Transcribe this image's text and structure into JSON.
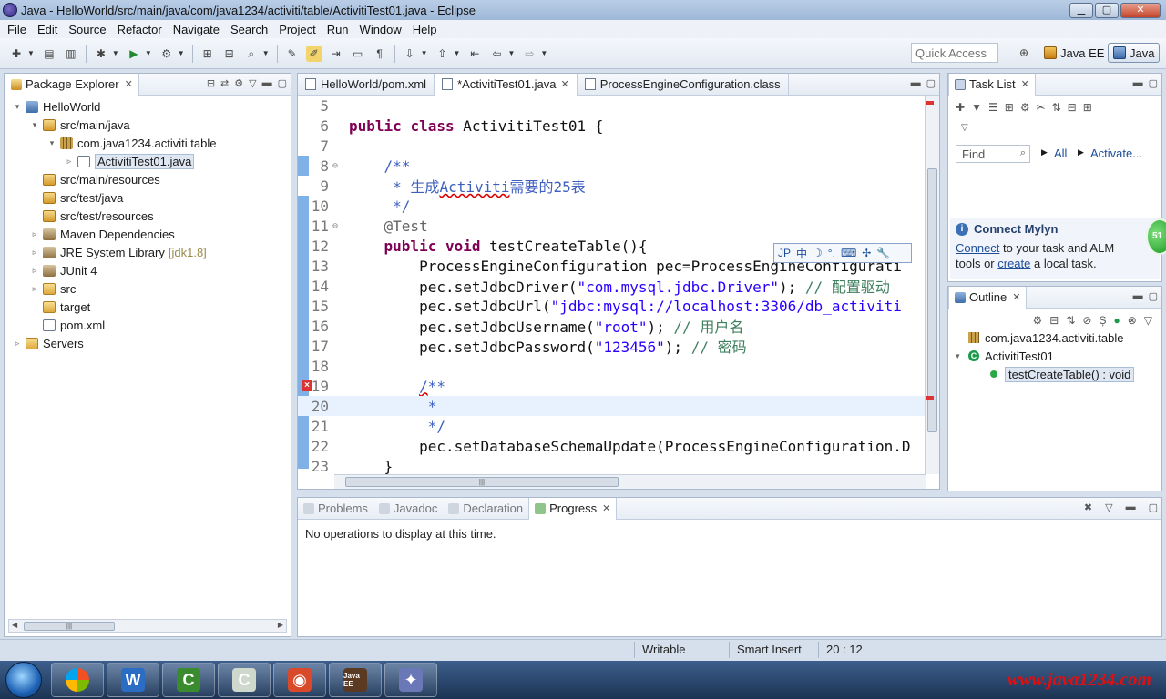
{
  "window": {
    "title": "Java - HelloWorld/src/main/java/com/java1234/activiti/table/ActivitiTest01.java - Eclipse",
    "minimize": "▁",
    "maximize": "▢",
    "close": "✕"
  },
  "menu": [
    "File",
    "Edit",
    "Source",
    "Refactor",
    "Navigate",
    "Search",
    "Project",
    "Run",
    "Window",
    "Help"
  ],
  "toolbar": {
    "quick_access": "Quick Access",
    "perspective_javaee": "Java EE",
    "perspective_java": "Java"
  },
  "package_explorer": {
    "tab_label": "Package Explorer",
    "tree": [
      {
        "label": "HelloWorld",
        "icon": "project-icon",
        "depth": 0,
        "twisty": "▾"
      },
      {
        "label": "src/main/java",
        "icon": "source-folder-icon",
        "depth": 1,
        "twisty": "▾"
      },
      {
        "label": "com.java1234.activiti.table",
        "icon": "package-icon",
        "depth": 2,
        "twisty": "▾"
      },
      {
        "label": "ActivitiTest01.java",
        "icon": "java-file-icon",
        "depth": 3,
        "twisty": "▹",
        "selected": true
      },
      {
        "label": "src/main/resources",
        "icon": "source-folder-icon",
        "depth": 1,
        "twisty": ""
      },
      {
        "label": "src/test/java",
        "icon": "source-folder-icon",
        "depth": 1,
        "twisty": ""
      },
      {
        "label": "src/test/resources",
        "icon": "source-folder-icon",
        "depth": 1,
        "twisty": ""
      },
      {
        "label": "Maven Dependencies",
        "icon": "library-icon",
        "depth": 1,
        "twisty": "▹"
      },
      {
        "label": "JRE System Library",
        "decor": "[jdk1.8]",
        "icon": "library-icon",
        "depth": 1,
        "twisty": "▹"
      },
      {
        "label": "JUnit 4",
        "icon": "library-icon",
        "depth": 1,
        "twisty": "▹"
      },
      {
        "label": "src",
        "icon": "folder-icon",
        "depth": 1,
        "twisty": "▹"
      },
      {
        "label": "target",
        "icon": "folder-icon",
        "depth": 1,
        "twisty": ""
      },
      {
        "label": "pom.xml",
        "icon": "xml-file-icon",
        "depth": 1,
        "twisty": ""
      },
      {
        "label": "Servers",
        "icon": "servers-folder-icon",
        "depth": 0,
        "twisty": "▹"
      }
    ]
  },
  "editor": {
    "tabs": [
      {
        "label": "HelloWorld/pom.xml",
        "active": false
      },
      {
        "label": "*ActivitiTest01.java",
        "active": true
      },
      {
        "label": "ProcessEngineConfiguration.class",
        "active": false
      }
    ],
    "lines": [
      {
        "n": "5",
        "fold": "",
        "html": ""
      },
      {
        "n": "6",
        "fold": "",
        "html": "<span class=\"kw\">public</span> <span class=\"kw\">class</span> ActivitiTest01 {"
      },
      {
        "n": "7",
        "fold": "",
        "html": ""
      },
      {
        "n": "8",
        "fold": "⊖",
        "html": "    <span class=\"jdoc\">/**</span>"
      },
      {
        "n": "9",
        "fold": "",
        "html": "<span class=\"jdoc\">     * 生成<span class=\"err-underline\">Activiti</span>需要的25表</span>"
      },
      {
        "n": "10",
        "fold": "",
        "html": "<span class=\"jdoc\">     */</span>"
      },
      {
        "n": "11",
        "fold": "⊖",
        "html": "    <span class=\"ann\">@Test</span>"
      },
      {
        "n": "12",
        "fold": "",
        "html": "    <span class=\"kw\">public</span> <span class=\"kw\">void</span> testCreateTable(){"
      },
      {
        "n": "13",
        "fold": "",
        "html": "        ProcessEngineConfiguration pec=ProcessEngineConfigurati"
      },
      {
        "n": "14",
        "fold": "",
        "html": "        pec.setJdbcDriver(<span class=\"str\">\"com.mysql.jdbc.Driver\"</span>); <span class=\"cmt\">// 配置驱动</span>"
      },
      {
        "n": "15",
        "fold": "",
        "html": "        pec.setJdbcUrl(<span class=\"str\">\"jdbc:mysql://localhost:3306/db_activiti</span>"
      },
      {
        "n": "16",
        "fold": "",
        "html": "        pec.setJdbcUsername(<span class=\"str\">\"root\"</span>); <span class=\"cmt\">// 用户名</span>"
      },
      {
        "n": "17",
        "fold": "",
        "html": "        pec.setJdbcPassword(<span class=\"str\">\"123456\"</span>); <span class=\"cmt\">// 密码</span>"
      },
      {
        "n": "18",
        "fold": "",
        "html": ""
      },
      {
        "n": "19",
        "fold": "",
        "html": "        <span class=\"jdoc\"><span class=\"err-underline\">/</span>**</span>"
      },
      {
        "n": "20",
        "fold": "",
        "html": "<span class=\"jdoc\">         *</span>",
        "current": true
      },
      {
        "n": "21",
        "fold": "",
        "html": "<span class=\"jdoc\">         */</span>"
      },
      {
        "n": "22",
        "fold": "",
        "html": "        pec.setDatabaseSchemaUpdate(ProcessEngineConfiguration.D"
      },
      {
        "n": "23",
        "fold": "",
        "html": "    }"
      }
    ],
    "ime_items": [
      "JP",
      "中",
      "☽",
      "°,",
      "⌨",
      "✢",
      "🔧"
    ]
  },
  "task_list": {
    "tab_label": "Task List",
    "find_placeholder": "Find",
    "all_label": "All",
    "activate_label": "Activate...",
    "mylyn_title": "Connect Mylyn",
    "mylyn_connect": "Connect",
    "mylyn_text1": " to your task and ALM",
    "mylyn_text2": "tools or ",
    "mylyn_create": "create",
    "mylyn_text3": " a local task."
  },
  "outline": {
    "tab_label": "Outline",
    "items": [
      {
        "label": "com.java1234.activiti.table",
        "icon": "package-icon",
        "depth": 0,
        "twisty": ""
      },
      {
        "label": "ActivitiTest01",
        "icon": "class-icon",
        "depth": 0,
        "twisty": "▾"
      },
      {
        "label": "testCreateTable() : void",
        "icon": "method-icon",
        "depth": 1,
        "twisty": "",
        "selected": true
      }
    ]
  },
  "bottom": {
    "tabs": [
      {
        "label": "Problems",
        "active": false
      },
      {
        "label": "Javadoc",
        "active": false
      },
      {
        "label": "Declaration",
        "active": false
      },
      {
        "label": "Progress",
        "active": true
      }
    ],
    "message": "No operations to display at this time."
  },
  "status": {
    "writable": "Writable",
    "insert_mode": "Smart Insert",
    "position": "20 : 12"
  },
  "taskbar": {
    "apps": [
      {
        "name": "word-app",
        "glyph": "W",
        "color": "#2b6cc4"
      },
      {
        "name": "camtasia-app",
        "glyph": "C",
        "color": "#3a8a2e"
      },
      {
        "name": "camtasia-recorder-app",
        "glyph": "C",
        "color": "#cfd8cc"
      },
      {
        "name": "chrome-app",
        "glyph": "◉",
        "color": "#d94a2a"
      },
      {
        "name": "eclipse-app",
        "glyph": "Java EE",
        "color": "#5a3a22"
      },
      {
        "name": "other-app",
        "glyph": "✦",
        "color": "#6a78b8"
      }
    ],
    "watermark": "www.java1234.com"
  }
}
